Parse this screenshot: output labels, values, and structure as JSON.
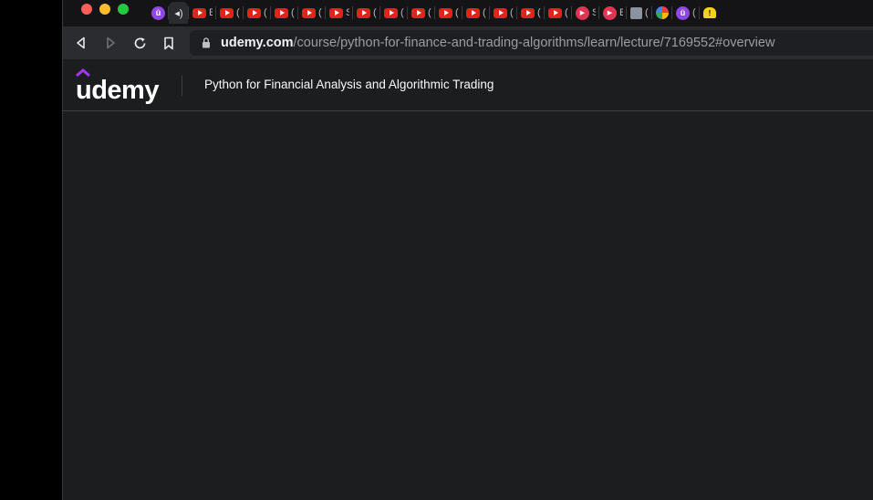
{
  "browser": {
    "tabs": [
      {
        "icon": "udemy-icon",
        "title": "",
        "active": false
      },
      {
        "icon": "speaker-icon",
        "title": "",
        "active": true
      },
      {
        "icon": "youtube-icon",
        "title": "E"
      },
      {
        "icon": "youtube-icon",
        "title": "("
      },
      {
        "icon": "youtube-icon",
        "title": "("
      },
      {
        "icon": "youtube-icon",
        "title": "("
      },
      {
        "icon": "youtube-icon",
        "title": "("
      },
      {
        "icon": "youtube-icon",
        "title": "S"
      },
      {
        "icon": "youtube-icon",
        "title": "("
      },
      {
        "icon": "youtube-icon",
        "title": "("
      },
      {
        "icon": "youtube-icon",
        "title": "("
      },
      {
        "icon": "youtube-icon",
        "title": "("
      },
      {
        "icon": "youtube-icon",
        "title": "("
      },
      {
        "icon": "youtube-icon",
        "title": "("
      },
      {
        "icon": "youtube-icon",
        "title": "("
      },
      {
        "icon": "youtube-icon",
        "title": "("
      },
      {
        "icon": "play-icon",
        "title": "S"
      },
      {
        "icon": "play-icon",
        "title": "E"
      },
      {
        "icon": "book-icon",
        "title": "("
      },
      {
        "icon": "google-icon",
        "title": ""
      },
      {
        "icon": "udemy-icon",
        "title": "("
      },
      {
        "icon": "warning-icon",
        "title": ""
      }
    ],
    "address": {
      "host": "udemy.com",
      "path": "/course/python-for-finance-and-trading-algorithms/learn/lecture/7169552#overview"
    }
  },
  "header": {
    "logo": "udemy",
    "course_title": "Python for Financial Analysis and Algorithmic Trading"
  },
  "colors": {
    "page_bg": "#1c1d1f",
    "toolbar_bg": "#2b2c30",
    "tabstrip_bg": "#141416",
    "brand_purple": "#a435f0"
  }
}
